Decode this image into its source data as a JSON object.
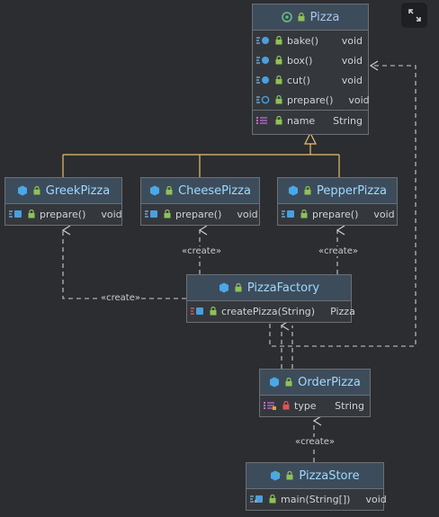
{
  "toolbar": {
    "expand_icon": "expand-icon"
  },
  "colors": {
    "background": "#2b2d30",
    "class_fill": "#34383d",
    "header_fill": "#3d4c5b",
    "border": "#6b7076",
    "inheritance": "#e8c26a",
    "dependency": "#c8ccd2",
    "class_name": "#9fd9ff"
  },
  "classes": {
    "pizza": {
      "name": "Pizza",
      "kind": "interface",
      "methods": [
        {
          "name": "bake()",
          "type": "void"
        },
        {
          "name": "box()",
          "type": "void"
        },
        {
          "name": "cut()",
          "type": "void"
        },
        {
          "name": "prepare()",
          "type": "void"
        }
      ],
      "fields": [
        {
          "name": "name",
          "type": "String"
        }
      ]
    },
    "greek_pizza": {
      "name": "GreekPizza",
      "methods": [
        {
          "name": "prepare()",
          "type": "void"
        }
      ]
    },
    "cheese_pizza": {
      "name": "CheesePizza",
      "methods": [
        {
          "name": "prepare()",
          "type": "void"
        }
      ]
    },
    "pepper_pizza": {
      "name": "PepperPizza",
      "methods": [
        {
          "name": "prepare()",
          "type": "void"
        }
      ]
    },
    "pizza_factory": {
      "name": "PizzaFactory",
      "methods": [
        {
          "name": "createPizza(String)",
          "type": "Pizza"
        }
      ]
    },
    "order_pizza": {
      "name": "OrderPizza",
      "fields": [
        {
          "name": "type",
          "type": "String"
        }
      ]
    },
    "pizza_store": {
      "name": "PizzaStore",
      "methods": [
        {
          "name": "main(String[])",
          "type": "void"
        }
      ]
    }
  },
  "edge_labels": {
    "create_cheese": "«create»",
    "create_pepper": "«create»",
    "create_greek": "«create»",
    "create_store": "«create»"
  }
}
